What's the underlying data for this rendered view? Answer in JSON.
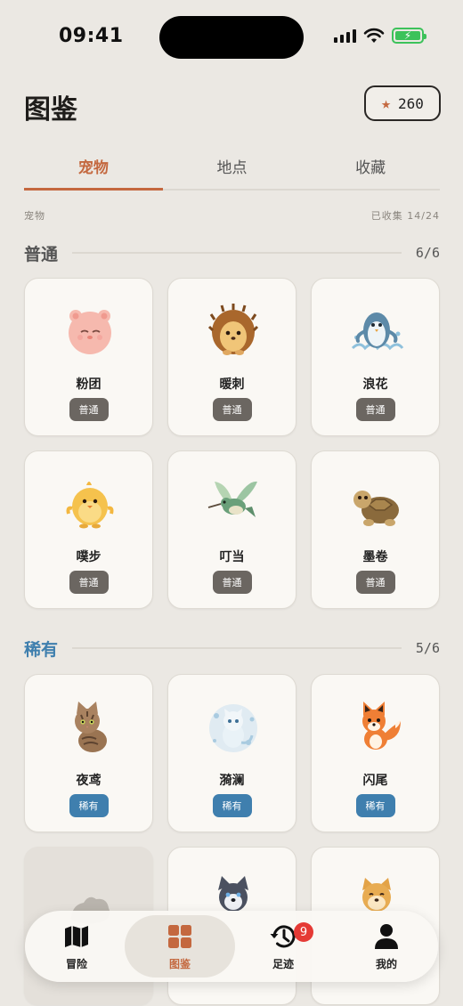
{
  "status": {
    "time": "09:41"
  },
  "header": {
    "title": "图鉴",
    "stars": "260"
  },
  "tabs": [
    {
      "label": "宠物",
      "active": true
    },
    {
      "label": "地点",
      "active": false
    },
    {
      "label": "收藏",
      "active": false
    }
  ],
  "subrow": {
    "left": "宠物",
    "right": "已收集 14/24"
  },
  "sections": [
    {
      "name": "普通",
      "count": "6/6",
      "pets": [
        {
          "name": "粉团",
          "tag": "普通",
          "icon": "pink-fluffball-icon"
        },
        {
          "name": "暖刺",
          "tag": "普通",
          "icon": "hedgehog-icon"
        },
        {
          "name": "浪花",
          "tag": "普通",
          "icon": "penguin-splash-icon"
        },
        {
          "name": "噗步",
          "tag": "普通",
          "icon": "chick-icon"
        },
        {
          "name": "叮当",
          "tag": "普通",
          "icon": "hummingbird-icon"
        },
        {
          "name": "墨卷",
          "tag": "普通",
          "icon": "turtle-icon"
        }
      ]
    },
    {
      "name": "稀有",
      "count": "5/6",
      "pets": [
        {
          "name": "夜鸢",
          "tag": "稀有",
          "icon": "tabby-cat-icon"
        },
        {
          "name": "漪澜",
          "tag": "稀有",
          "icon": "water-spirit-icon"
        },
        {
          "name": "闪尾",
          "tag": "稀有",
          "icon": "fox-icon"
        }
      ]
    }
  ],
  "nav": [
    {
      "label": "冒险",
      "icon": "map-icon"
    },
    {
      "label": "图鉴",
      "icon": "grid-icon",
      "active": true
    },
    {
      "label": "足迹",
      "icon": "history-icon",
      "badge": "9"
    },
    {
      "label": "我的",
      "icon": "person-icon"
    }
  ],
  "colors": {
    "accent": "#c4683f",
    "rare": "#3f7fae",
    "common_tag": "#6b6661",
    "background": "#ebe8e3"
  }
}
